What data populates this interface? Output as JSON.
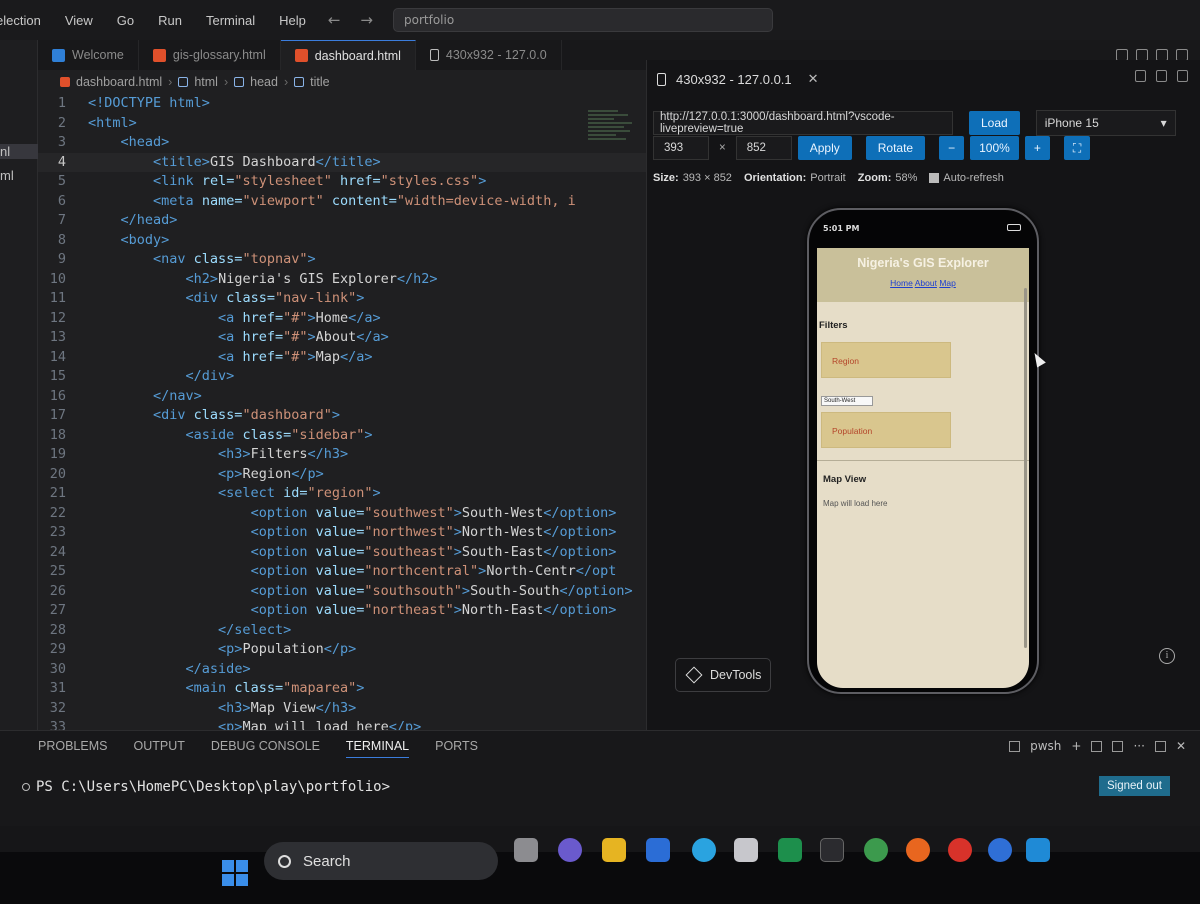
{
  "menubar": {
    "items": [
      "election",
      "View",
      "Go",
      "Run",
      "Terminal",
      "Help"
    ],
    "command_center": "portfolio"
  },
  "explorer": {
    "items": [
      "nl",
      "ml"
    ]
  },
  "tabs": [
    {
      "label": "Welcome",
      "icon": "vscode-icon",
      "active": false
    },
    {
      "label": "gis-glossary.html",
      "icon": "html-icon",
      "active": false
    },
    {
      "label": "dashboard.html",
      "icon": "html-icon",
      "active": true
    },
    {
      "label": "430x932 - 127.0.0",
      "icon": "device-icon",
      "active": false
    }
  ],
  "breadcrumb": [
    "dashboard.html",
    "html",
    "head",
    "title"
  ],
  "editor": {
    "current_line": 4,
    "lines": [
      [
        [
          "tg",
          "<!DOCTYPE html>"
        ]
      ],
      [
        [
          "tg",
          "<html>"
        ]
      ],
      [
        [
          "txt",
          "    "
        ],
        [
          "tg",
          "<head>"
        ]
      ],
      [
        [
          "txt",
          "        "
        ],
        [
          "tg",
          "<title>"
        ],
        [
          "txt",
          "GIS Dashboard"
        ],
        [
          "tg",
          "</title>"
        ]
      ],
      [
        [
          "txt",
          "        "
        ],
        [
          "tg",
          "<link "
        ],
        [
          "at",
          "rel="
        ],
        [
          "st",
          "\"stylesheet\" "
        ],
        [
          "at",
          "href="
        ],
        [
          "st",
          "\"styles.css\""
        ],
        [
          "tg",
          ">"
        ]
      ],
      [
        [
          "txt",
          "        "
        ],
        [
          "tg",
          "<meta "
        ],
        [
          "at",
          "name="
        ],
        [
          "st",
          "\"viewport\" "
        ],
        [
          "at",
          "content="
        ],
        [
          "st",
          "\"width=device-width, i"
        ]
      ],
      [
        [
          "txt",
          "    "
        ],
        [
          "tg",
          "</head>"
        ]
      ],
      [
        [
          "txt",
          "    "
        ],
        [
          "tg",
          "<body>"
        ]
      ],
      [
        [
          "txt",
          "        "
        ],
        [
          "tg",
          "<nav "
        ],
        [
          "at",
          "class="
        ],
        [
          "st",
          "\"topnav\""
        ],
        [
          "tg",
          ">"
        ]
      ],
      [
        [
          "txt",
          "            "
        ],
        [
          "tg",
          "<h2>"
        ],
        [
          "txt",
          "Nigeria's GIS Explorer"
        ],
        [
          "tg",
          "</h2>"
        ]
      ],
      [
        [
          "txt",
          "            "
        ],
        [
          "tg",
          "<div "
        ],
        [
          "at",
          "class="
        ],
        [
          "st",
          "\"nav-link\""
        ],
        [
          "tg",
          ">"
        ]
      ],
      [
        [
          "txt",
          "                "
        ],
        [
          "tg",
          "<a "
        ],
        [
          "at",
          "href="
        ],
        [
          "st",
          "\"#\""
        ],
        [
          "tg",
          ">"
        ],
        [
          "txt",
          "Home"
        ],
        [
          "tg",
          "</a>"
        ]
      ],
      [
        [
          "txt",
          "                "
        ],
        [
          "tg",
          "<a "
        ],
        [
          "at",
          "href="
        ],
        [
          "st",
          "\"#\""
        ],
        [
          "tg",
          ">"
        ],
        [
          "txt",
          "About"
        ],
        [
          "tg",
          "</a>"
        ]
      ],
      [
        [
          "txt",
          "                "
        ],
        [
          "tg",
          "<a "
        ],
        [
          "at",
          "href="
        ],
        [
          "st",
          "\"#\""
        ],
        [
          "tg",
          ">"
        ],
        [
          "txt",
          "Map"
        ],
        [
          "tg",
          "</a>"
        ]
      ],
      [
        [
          "txt",
          "            "
        ],
        [
          "tg",
          "</div>"
        ]
      ],
      [
        [
          "txt",
          "        "
        ],
        [
          "tg",
          "</nav>"
        ]
      ],
      [
        [
          "txt",
          "        "
        ],
        [
          "tg",
          "<div "
        ],
        [
          "at",
          "class="
        ],
        [
          "st",
          "\"dashboard\""
        ],
        [
          "tg",
          ">"
        ]
      ],
      [
        [
          "txt",
          "            "
        ],
        [
          "tg",
          "<aside "
        ],
        [
          "at",
          "class="
        ],
        [
          "st",
          "\"sidebar\""
        ],
        [
          "tg",
          ">"
        ]
      ],
      [
        [
          "txt",
          "                "
        ],
        [
          "tg",
          "<h3>"
        ],
        [
          "txt",
          "Filters"
        ],
        [
          "tg",
          "</h3>"
        ]
      ],
      [
        [
          "txt",
          "                "
        ],
        [
          "tg",
          "<p>"
        ],
        [
          "txt",
          "Region"
        ],
        [
          "tg",
          "</p>"
        ]
      ],
      [
        [
          "txt",
          "                "
        ],
        [
          "tg",
          "<select "
        ],
        [
          "at",
          "id="
        ],
        [
          "st",
          "\"region\""
        ],
        [
          "tg",
          ">"
        ]
      ],
      [
        [
          "txt",
          "                    "
        ],
        [
          "tg",
          "<option "
        ],
        [
          "at",
          "value="
        ],
        [
          "st",
          "\"southwest\""
        ],
        [
          "tg",
          ">"
        ],
        [
          "txt",
          "South-West"
        ],
        [
          "tg",
          "</option>"
        ]
      ],
      [
        [
          "txt",
          "                    "
        ],
        [
          "tg",
          "<option "
        ],
        [
          "at",
          "value="
        ],
        [
          "st",
          "\"northwest\""
        ],
        [
          "tg",
          ">"
        ],
        [
          "txt",
          "North-West"
        ],
        [
          "tg",
          "</option>"
        ]
      ],
      [
        [
          "txt",
          "                    "
        ],
        [
          "tg",
          "<option "
        ],
        [
          "at",
          "value="
        ],
        [
          "st",
          "\"southeast\""
        ],
        [
          "tg",
          ">"
        ],
        [
          "txt",
          "South-East"
        ],
        [
          "tg",
          "</option>"
        ]
      ],
      [
        [
          "txt",
          "                    "
        ],
        [
          "tg",
          "<option "
        ],
        [
          "at",
          "value="
        ],
        [
          "st",
          "\"northcentral\""
        ],
        [
          "tg",
          ">"
        ],
        [
          "txt",
          "North-Centr"
        ],
        [
          "tg",
          "</opt"
        ]
      ],
      [
        [
          "txt",
          "                    "
        ],
        [
          "tg",
          "<option "
        ],
        [
          "at",
          "value="
        ],
        [
          "st",
          "\"southsouth\""
        ],
        [
          "tg",
          ">"
        ],
        [
          "txt",
          "South-South"
        ],
        [
          "tg",
          "</option>"
        ]
      ],
      [
        [
          "txt",
          "                    "
        ],
        [
          "tg",
          "<option "
        ],
        [
          "at",
          "value="
        ],
        [
          "st",
          "\"northeast\""
        ],
        [
          "tg",
          ">"
        ],
        [
          "txt",
          "North-East"
        ],
        [
          "tg",
          "</option>"
        ]
      ],
      [
        [
          "txt",
          "                "
        ],
        [
          "tg",
          "</select>"
        ]
      ],
      [
        [
          "txt",
          "                "
        ],
        [
          "tg",
          "<p>"
        ],
        [
          "txt",
          "Population"
        ],
        [
          "tg",
          "</p>"
        ]
      ],
      [
        [
          "txt",
          "            "
        ],
        [
          "tg",
          "</aside>"
        ]
      ],
      [
        [
          "txt",
          "            "
        ],
        [
          "tg",
          "<main "
        ],
        [
          "at",
          "class="
        ],
        [
          "st",
          "\"maparea\""
        ],
        [
          "tg",
          ">"
        ]
      ],
      [
        [
          "txt",
          "                "
        ],
        [
          "tg",
          "<h3>"
        ],
        [
          "txt",
          "Map View"
        ],
        [
          "tg",
          "</h3>"
        ]
      ],
      [
        [
          "txt",
          "                "
        ],
        [
          "tg",
          "<p>"
        ],
        [
          "txt",
          "Map will load here"
        ],
        [
          "tg",
          "</p>"
        ]
      ]
    ]
  },
  "preview": {
    "tab_label": "430x932 - 127.0.0.1",
    "url": "http://127.0.0.1:3000/dashboard.html?vscode-livepreview=true",
    "load_label": "Load",
    "device": "iPhone 15",
    "width": "393",
    "times": "×",
    "height": "852",
    "apply_label": "Apply",
    "rotate_label": "Rotate",
    "zoom_minus": "−",
    "zoom_value": "100%",
    "zoom_plus": "+",
    "size_label": "Size:",
    "size_value": "393 × 852",
    "orientation_label": "Orientation:",
    "orientation_value": "Portrait",
    "zoom_label": "Zoom:",
    "zoom_percent": "58%",
    "autorefresh_label": "Auto-refresh",
    "devtools_label": "DevTools",
    "info_glyph": "i",
    "phone": {
      "time": "5:01 PM",
      "site_title": "Nigeria's GIS Explorer",
      "links": [
        "Home",
        "About",
        "Map"
      ],
      "filters_heading": "Filters",
      "region_label": "Region",
      "select_value": "South-West",
      "population_label": "Population",
      "map_heading": "Map View",
      "map_text": "Map will load here"
    }
  },
  "panel": {
    "tabs": [
      "PROBLEMS",
      "OUTPUT",
      "DEBUG CONSOLE",
      "TERMINAL",
      "PORTS"
    ],
    "active_tab": "TERMINAL",
    "shell": "pwsh",
    "prompt": "PS C:\\Users\\HomePC\\Desktop\\play\\portfolio>"
  },
  "status": {
    "signed_out": "Signed out"
  },
  "taskbar": {
    "search_placeholder": "Search"
  },
  "colors": {
    "accent": "#0e6fb8",
    "tag": "#569cd6",
    "attr": "#9cdcfe",
    "string": "#ce9178"
  }
}
